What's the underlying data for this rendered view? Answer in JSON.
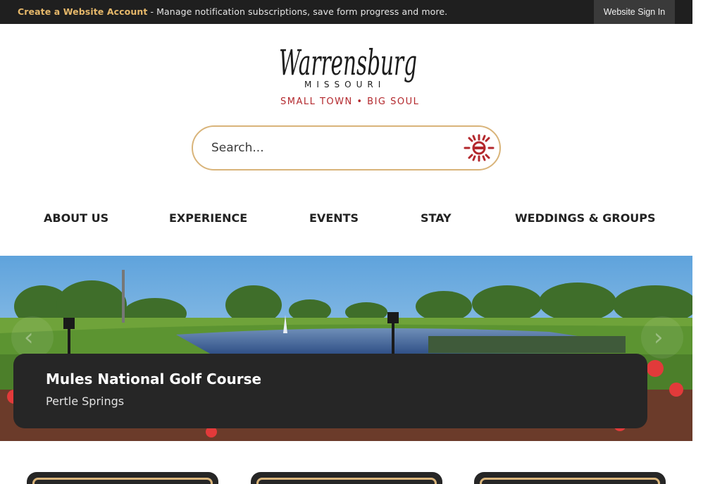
{
  "topbar": {
    "create_link": "Create a Website Account",
    "message": " - Manage notification subscriptions, save form progress and more.",
    "signin_label": "Website Sign In"
  },
  "logo": {
    "script_text": "Warrensburg",
    "state_text": "MISSOURI",
    "tagline": "SMALL  TOWN • BIG  SOUL"
  },
  "search": {
    "placeholder": "Search..."
  },
  "nav": {
    "items": [
      {
        "label": "ABOUT US"
      },
      {
        "label": "EXPERIENCE"
      },
      {
        "label": "EVENTS"
      },
      {
        "label": "STAY"
      },
      {
        "label": "WEDDINGS & GROUPS"
      }
    ]
  },
  "hero": {
    "title": "Mules National Golf Course",
    "subtitle": "Pertle Springs",
    "prev_icon": "chevron-left-icon",
    "next_icon": "chevron-right-icon"
  },
  "colors": {
    "topbar_bg": "#1f1f1f",
    "accent_gold": "#d9b47a",
    "brand_red": "#b3282d",
    "caption_bg": "#262626"
  }
}
